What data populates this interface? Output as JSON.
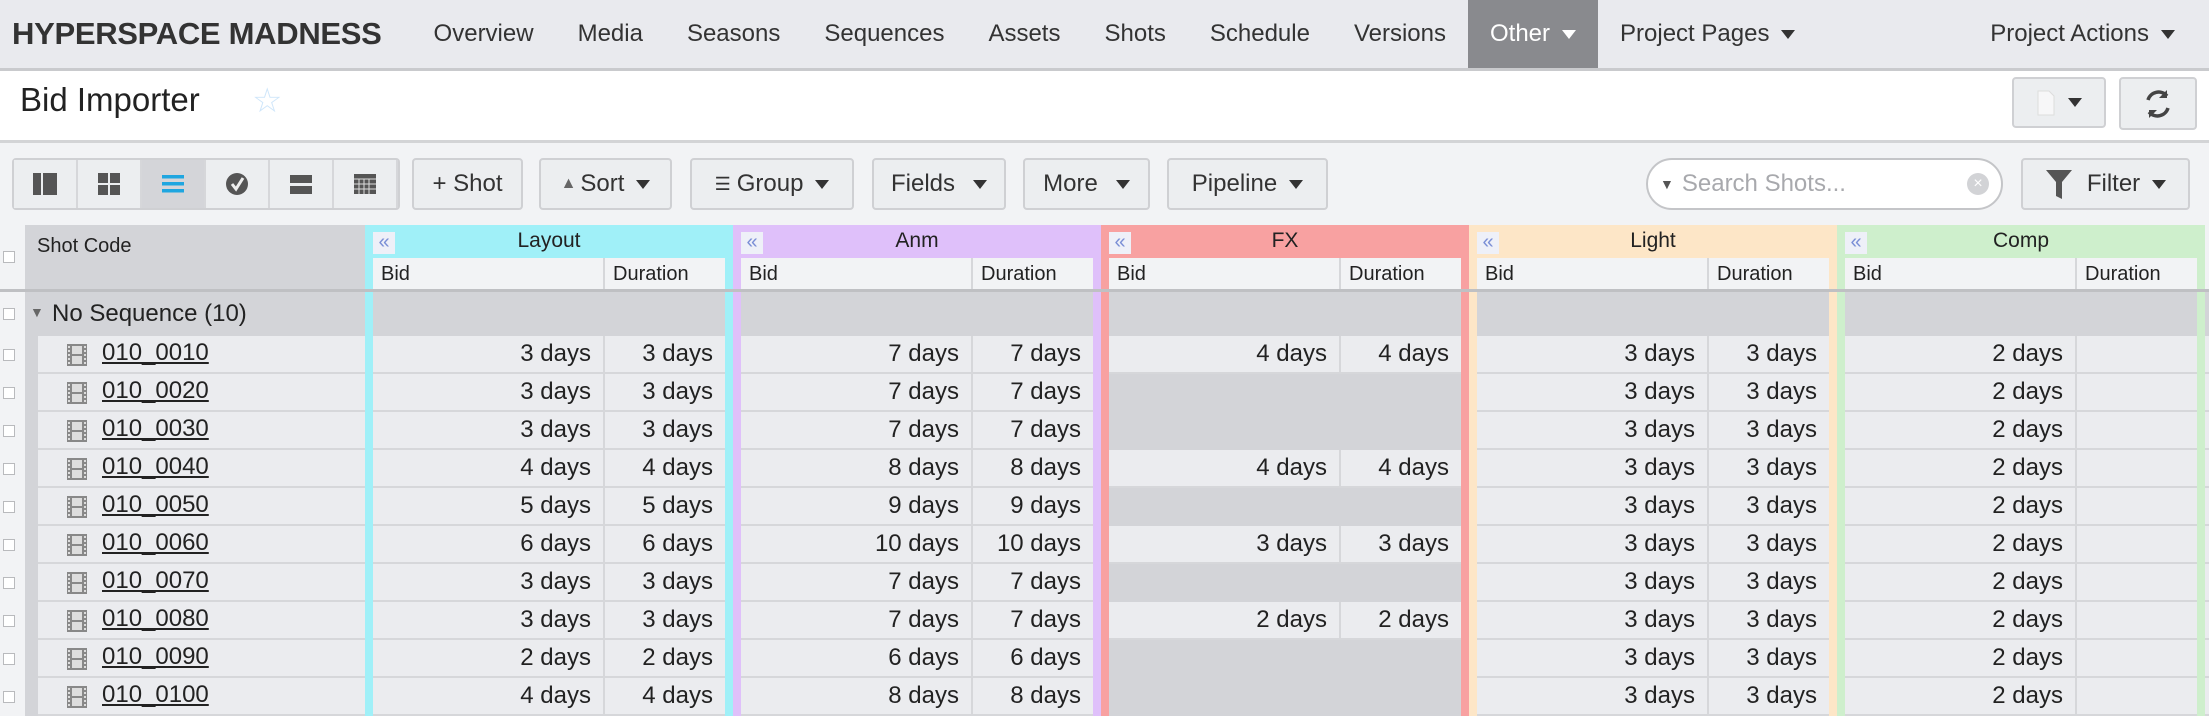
{
  "nav": {
    "brand": "HYPERSPACE MADNESS",
    "items": [
      {
        "label": "Overview"
      },
      {
        "label": "Media"
      },
      {
        "label": "Seasons"
      },
      {
        "label": "Sequences"
      },
      {
        "label": "Assets"
      },
      {
        "label": "Shots"
      },
      {
        "label": "Schedule"
      },
      {
        "label": "Versions"
      },
      {
        "label": "Other",
        "active": true,
        "dropdown": true
      },
      {
        "label": "Project Pages",
        "dropdown": true
      }
    ],
    "actions": "Project Actions"
  },
  "page": {
    "title": "Bid Importer",
    "favorite": false
  },
  "toolbar": {
    "views": [
      "column-view-icon",
      "thumbnail-view-icon",
      "list-view-icon",
      "task-status-icon",
      "row-view-icon",
      "spreadsheet-view-icon"
    ],
    "selected_view": 2,
    "add_shot": "+ Shot",
    "sort": "Sort",
    "group": "Group",
    "fields": "Fields",
    "more": "More",
    "pipeline": "Pipeline",
    "search_placeholder": "Search Shots...",
    "filter": "Filter"
  },
  "grid": {
    "shot_code_header": "Shot Code",
    "sub_headers": {
      "bid": "Bid",
      "duration": "Duration"
    },
    "groups": [
      {
        "name": "Layout",
        "color": "#a0f0f8"
      },
      {
        "name": "Anm",
        "color": "#dfc0fa"
      },
      {
        "name": "FX",
        "color": "#f8a1a1"
      },
      {
        "name": "Light",
        "color": "#fde6c7"
      },
      {
        "name": "Comp",
        "color": "#ceefcc"
      }
    ],
    "group_row": "No Sequence (10)",
    "rows": [
      {
        "code": "010_0010",
        "values": [
          [
            "3 days",
            "3 days"
          ],
          [
            "7 days",
            "7 days"
          ],
          [
            "4 days",
            "4 days"
          ],
          [
            "3 days",
            "3 days"
          ],
          [
            "2 days",
            ""
          ]
        ]
      },
      {
        "code": "010_0020",
        "values": [
          [
            "3 days",
            "3 days"
          ],
          [
            "7 days",
            "7 days"
          ],
          [
            "",
            ""
          ],
          [
            "3 days",
            "3 days"
          ],
          [
            "2 days",
            ""
          ]
        ]
      },
      {
        "code": "010_0030",
        "values": [
          [
            "3 days",
            "3 days"
          ],
          [
            "7 days",
            "7 days"
          ],
          [
            "",
            ""
          ],
          [
            "3 days",
            "3 days"
          ],
          [
            "2 days",
            ""
          ]
        ]
      },
      {
        "code": "010_0040",
        "values": [
          [
            "4 days",
            "4 days"
          ],
          [
            "8 days",
            "8 days"
          ],
          [
            "4 days",
            "4 days"
          ],
          [
            "3 days",
            "3 days"
          ],
          [
            "2 days",
            ""
          ]
        ]
      },
      {
        "code": "010_0050",
        "values": [
          [
            "5 days",
            "5 days"
          ],
          [
            "9 days",
            "9 days"
          ],
          [
            "",
            ""
          ],
          [
            "3 days",
            "3 days"
          ],
          [
            "2 days",
            ""
          ]
        ]
      },
      {
        "code": "010_0060",
        "values": [
          [
            "6 days",
            "6 days"
          ],
          [
            "10 days",
            "10 days"
          ],
          [
            "3 days",
            "3 days"
          ],
          [
            "3 days",
            "3 days"
          ],
          [
            "2 days",
            ""
          ]
        ]
      },
      {
        "code": "010_0070",
        "values": [
          [
            "3 days",
            "3 days"
          ],
          [
            "7 days",
            "7 days"
          ],
          [
            "",
            ""
          ],
          [
            "3 days",
            "3 days"
          ],
          [
            "2 days",
            ""
          ]
        ]
      },
      {
        "code": "010_0080",
        "values": [
          [
            "3 days",
            "3 days"
          ],
          [
            "7 days",
            "7 days"
          ],
          [
            "2 days",
            "2 days"
          ],
          [
            "3 days",
            "3 days"
          ],
          [
            "2 days",
            ""
          ]
        ]
      },
      {
        "code": "010_0090",
        "values": [
          [
            "2 days",
            "2 days"
          ],
          [
            "6 days",
            "6 days"
          ],
          [
            "",
            ""
          ],
          [
            "3 days",
            "3 days"
          ],
          [
            "2 days",
            ""
          ]
        ]
      },
      {
        "code": "010_0100",
        "values": [
          [
            "4 days",
            "4 days"
          ],
          [
            "8 days",
            "8 days"
          ],
          [
            "",
            ""
          ],
          [
            "3 days",
            "3 days"
          ],
          [
            "2 days",
            ""
          ]
        ]
      }
    ]
  }
}
